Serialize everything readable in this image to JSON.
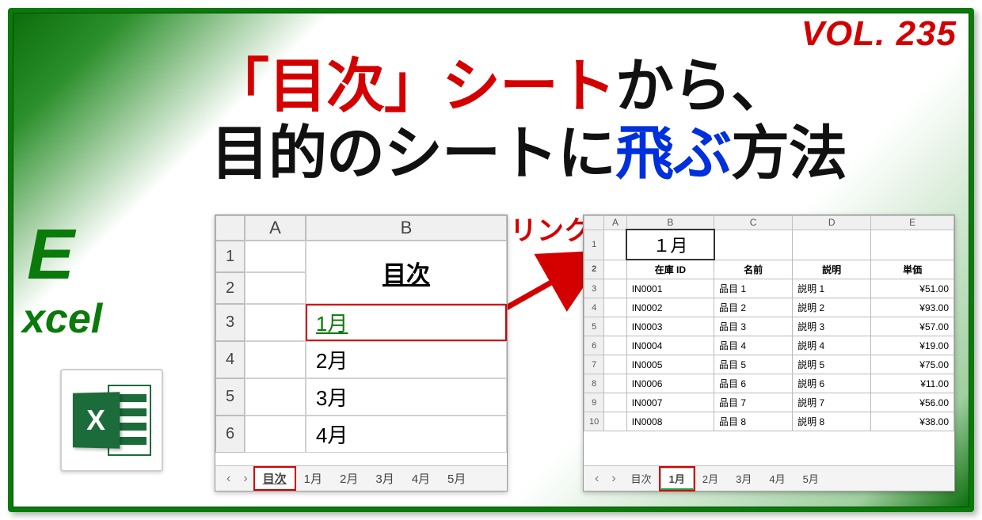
{
  "volume": "VOL. 235",
  "title": {
    "line1_red": "「目次」シート",
    "line1_black": "から、",
    "line2_a": "目的のシートに",
    "line2_blue": "飛ぶ",
    "line2_b": "方法"
  },
  "side_brand_E": "E",
  "side_brand_rest": "xcel",
  "icon_x": "X",
  "annot_link": "リンク",
  "panel_left": {
    "cols": [
      "",
      "A",
      "B"
    ],
    "rows": [
      "1",
      "2",
      "3",
      "4",
      "5",
      "6"
    ],
    "heading": "目次",
    "items": [
      "1月",
      "2月",
      "3月",
      "4月"
    ],
    "tabs": [
      "目次",
      "1月",
      "2月",
      "3月",
      "4月",
      "5月"
    ],
    "active_tab": "目次"
  },
  "panel_right": {
    "cols": [
      "",
      "A",
      "B",
      "C",
      "D",
      "E"
    ],
    "rows": [
      "1",
      "2",
      "3",
      "4",
      "5",
      "6",
      "7",
      "8",
      "9",
      "10"
    ],
    "title_cell": "１月",
    "headers": [
      "在庫 ID",
      "名前",
      "説明",
      "単価"
    ],
    "data": [
      {
        "id": "IN0001",
        "name": "品目 1",
        "desc": "説明 1",
        "price": "¥51.00"
      },
      {
        "id": "IN0002",
        "name": "品目 2",
        "desc": "説明 2",
        "price": "¥93.00"
      },
      {
        "id": "IN0003",
        "name": "品目 3",
        "desc": "説明 3",
        "price": "¥57.00"
      },
      {
        "id": "IN0004",
        "name": "品目 4",
        "desc": "説明 4",
        "price": "¥19.00"
      },
      {
        "id": "IN0005",
        "name": "品目 5",
        "desc": "説明 5",
        "price": "¥75.00"
      },
      {
        "id": "IN0006",
        "name": "品目 6",
        "desc": "説明 6",
        "price": "¥11.00"
      },
      {
        "id": "IN0007",
        "name": "品目 7",
        "desc": "説明 7",
        "price": "¥56.00"
      },
      {
        "id": "IN0008",
        "name": "品目 8",
        "desc": "説明 8",
        "price": "¥38.00"
      }
    ],
    "tabs": [
      "目次",
      "1月",
      "2月",
      "3月",
      "4月",
      "5月"
    ],
    "active_tab": "1月"
  },
  "nav_prev": "‹",
  "nav_next": "›"
}
